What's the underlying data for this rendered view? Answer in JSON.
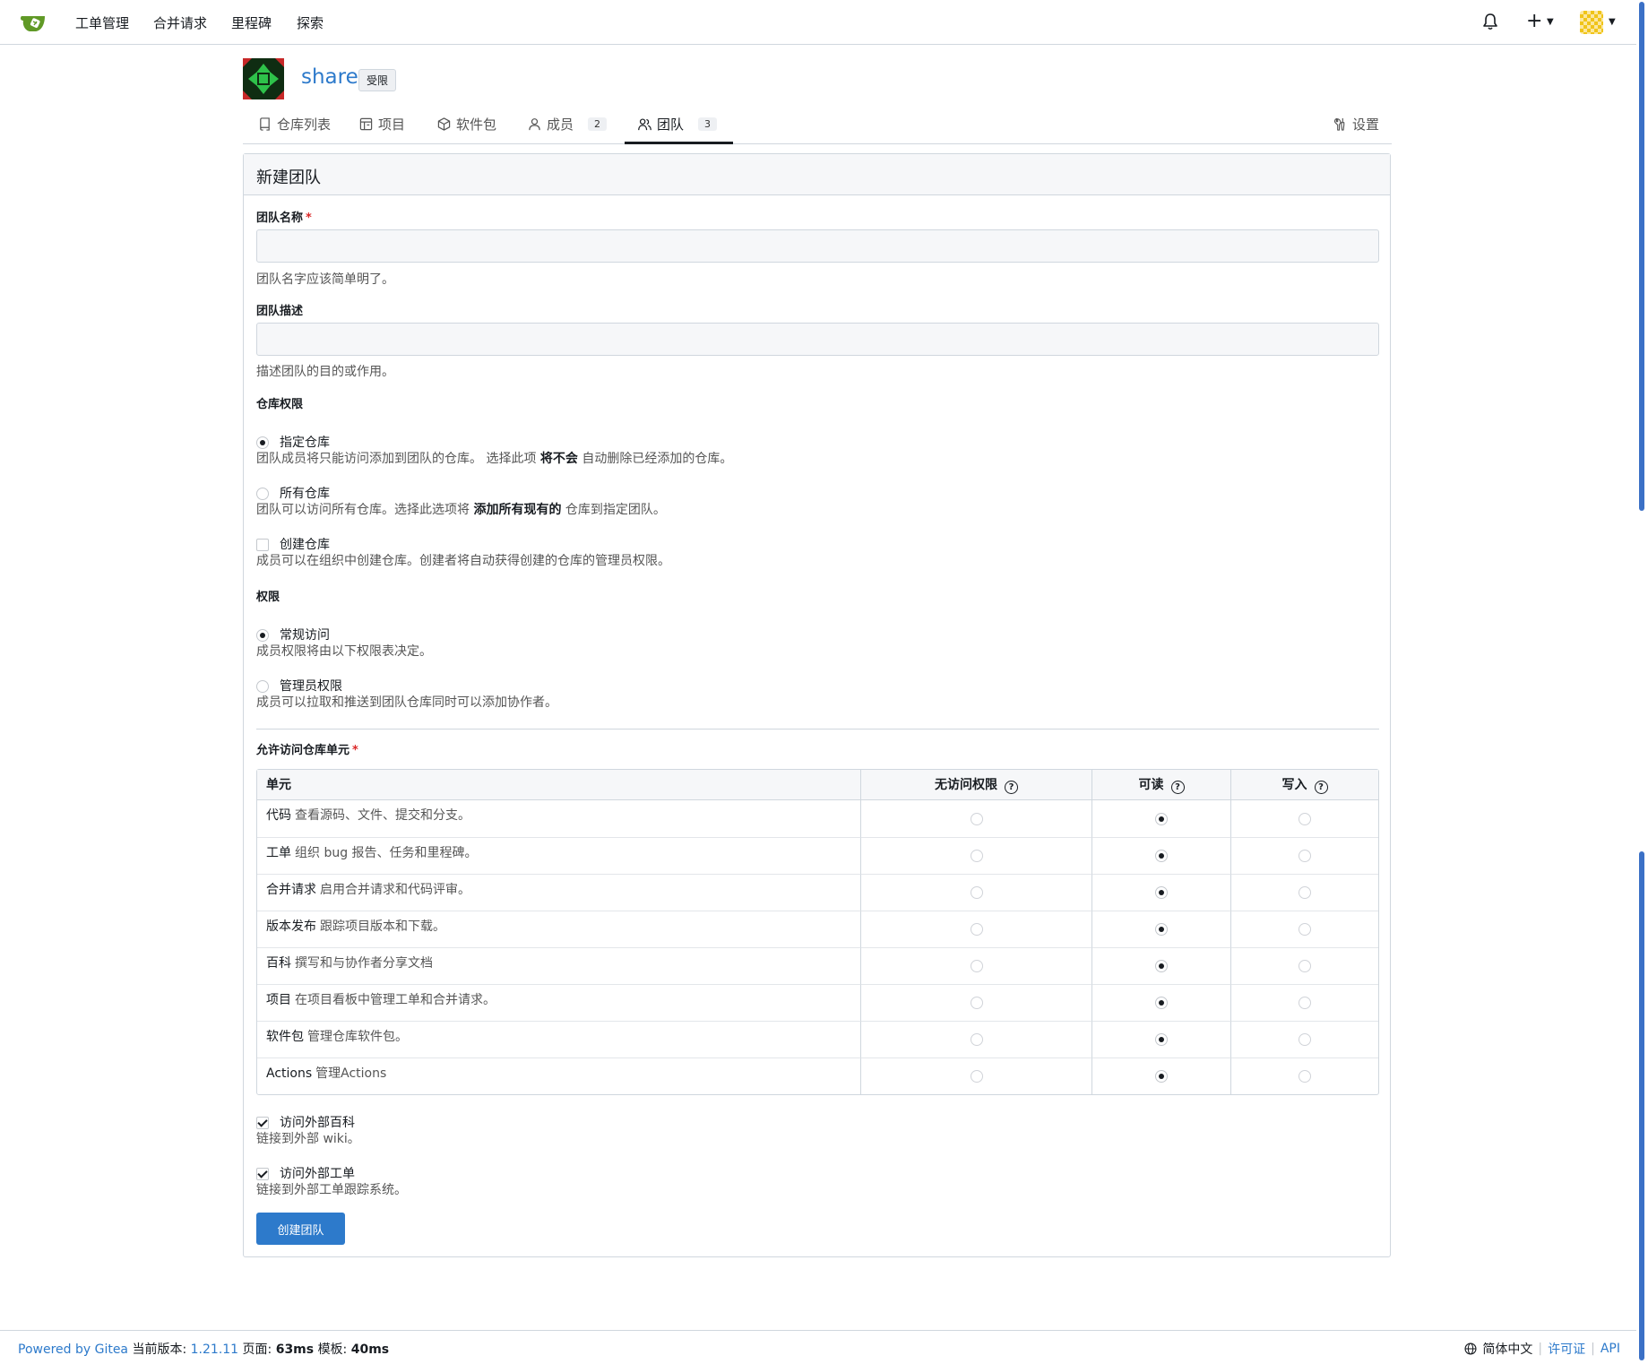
{
  "topnav": {
    "items": [
      "工单管理",
      "合并请求",
      "里程碑",
      "探索"
    ]
  },
  "org": {
    "name": "share",
    "visibility_badge": "受限"
  },
  "tabs": [
    {
      "label": "仓库列表",
      "icon": "repo-icon"
    },
    {
      "label": "项目",
      "icon": "project-icon"
    },
    {
      "label": "软件包",
      "icon": "package-icon"
    },
    {
      "label": "成员",
      "icon": "person-icon",
      "count": "2"
    },
    {
      "label": "团队",
      "icon": "people-icon",
      "count": "3",
      "active": true
    },
    {
      "label": "设置",
      "icon": "tools-icon"
    }
  ],
  "form": {
    "title": "新建团队",
    "team_name": {
      "label": "团队名称",
      "value": "",
      "help": "团队名字应该简单明了。"
    },
    "team_desc": {
      "label": "团队描述",
      "value": "",
      "help": "描述团队的目的或作用。"
    },
    "repo_access": {
      "label": "仓库权限",
      "specific": {
        "label": "指定仓库",
        "help_pre": "团队成员将只能访问添加到团队的仓库。 选择此项 ",
        "help_bold": "将不会",
        "help_post": " 自动删除已经添加的仓库。",
        "checked": true
      },
      "all": {
        "label": "所有仓库",
        "help_pre": "团队可以访问所有仓库。选择此选项将 ",
        "help_bold": "添加所有现有的",
        "help_post": " 仓库到指定团队。",
        "checked": false
      },
      "create": {
        "label": "创建仓库",
        "help": "成员可以在组织中创建仓库。创建者将自动获得创建的仓库的管理员权限。",
        "checked": false
      }
    },
    "permission": {
      "label": "权限",
      "general": {
        "label": "常规访问",
        "help": "成员权限将由以下权限表决定。",
        "checked": true
      },
      "admin": {
        "label": "管理员权限",
        "help": "成员可以拉取和推送到团队仓库同时可以添加协作者。",
        "checked": false
      }
    },
    "units": {
      "label": "允许访问仓库单元",
      "columns": [
        "单元",
        "无访问权限",
        "可读",
        "写入"
      ],
      "rows": [
        {
          "name": "代码",
          "desc": "查看源码、文件、提交和分支。",
          "level": "read"
        },
        {
          "name": "工单",
          "desc": "组织 bug 报告、任务和里程碑。",
          "level": "read"
        },
        {
          "name": "合并请求",
          "desc": "启用合并请求和代码评审。",
          "level": "read"
        },
        {
          "name": "版本发布",
          "desc": "跟踪项目版本和下载。",
          "level": "read"
        },
        {
          "name": "百科",
          "desc": "撰写和与协作者分享文档",
          "level": "read"
        },
        {
          "name": "项目",
          "desc": "在项目看板中管理工单和合并请求。",
          "level": "read"
        },
        {
          "name": "软件包",
          "desc": "管理仓库软件包。",
          "level": "read"
        },
        {
          "name": "Actions",
          "desc": "管理Actions",
          "level": "read"
        }
      ]
    },
    "ext_wiki": {
      "label": "访问外部百科",
      "help": "链接到外部 wiki。",
      "checked": true
    },
    "ext_tracker": {
      "label": "访问外部工单",
      "help": "链接到外部工单跟踪系统。",
      "checked": true
    },
    "submit_label": "创建团队"
  },
  "footer": {
    "powered": "Powered by Gitea",
    "version_label": "当前版本:",
    "version": "1.21.11",
    "page_label": "页面:",
    "page_time": "63ms",
    "tmpl_label": "模板:",
    "tmpl_time": "40ms",
    "language": "简体中文",
    "license": "许可证",
    "api": "API"
  },
  "colors": {
    "accent": "#2d7acb",
    "required": "#db2828"
  }
}
